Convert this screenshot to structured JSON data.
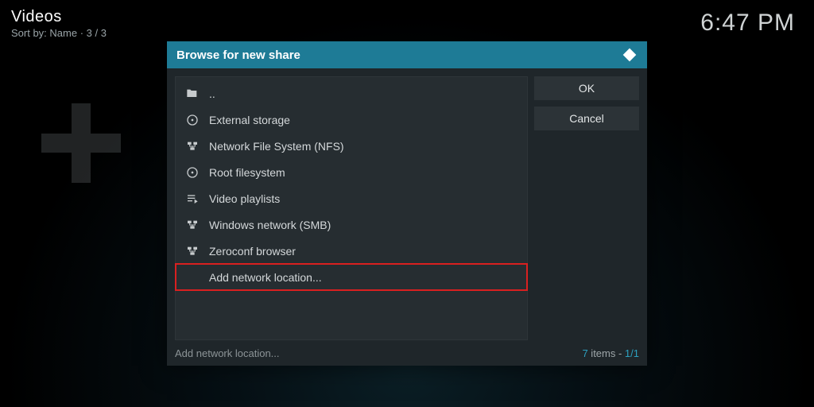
{
  "header": {
    "title": "Videos",
    "subtitle": "Sort by: Name  ·  3 / 3"
  },
  "clock": "6:47 PM",
  "dialog": {
    "title": "Browse for new share",
    "items": [
      {
        "icon": "folder-icon",
        "label": ".."
      },
      {
        "icon": "disc-icon",
        "label": "External storage"
      },
      {
        "icon": "network-icon",
        "label": "Network File System (NFS)"
      },
      {
        "icon": "disc-icon",
        "label": "Root filesystem"
      },
      {
        "icon": "playlist-icon",
        "label": "Video playlists"
      },
      {
        "icon": "network-icon",
        "label": "Windows network (SMB)"
      },
      {
        "icon": "network-icon",
        "label": "Zeroconf browser"
      },
      {
        "icon": "none",
        "label": "Add network location...",
        "highlight": true
      }
    ],
    "buttons": {
      "ok": "OK",
      "cancel": "Cancel"
    },
    "footer": {
      "status": "Add network location...",
      "count_num": "7",
      "count_label": " items - ",
      "page": "1/1"
    }
  }
}
